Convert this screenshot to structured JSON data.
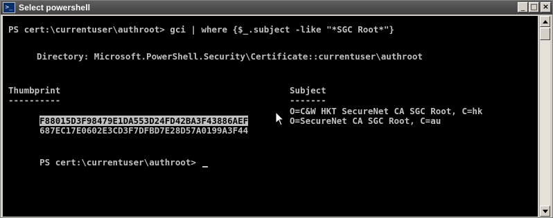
{
  "window": {
    "title": "Select powershell",
    "icon_text": ">_",
    "minimize_label": "_",
    "maximize_label": "□",
    "close_label": "×"
  },
  "console": {
    "command_line": "PS cert:\\currentuser\\authroot> gci | where {$_.subject -like \"*SGC Root*\"}",
    "directory_line": "Directory: Microsoft.PowerShell.Security\\Certificate::currentuser\\authroot",
    "headers": {
      "thumbprint": "Thumbprint",
      "subject": "Subject"
    },
    "underlines": {
      "thumbprint": "----------",
      "subject": "-------"
    },
    "rows": [
      {
        "thumbprint": "F88015D3F98479E1DA553D24FD42BA3F43886AEF",
        "subject": "O=C&W HKT SecureNet CA SGC Root, C=hk"
      },
      {
        "thumbprint": "687EC17E0602E3CD3F7DFBD7E28D57A0199A3F44",
        "subject": "O=SecureNet CA SGC Root, C=au"
      }
    ],
    "prompt_line": "PS cert:\\currentuser\\authroot> "
  },
  "colors": {
    "console_bg": "#000000",
    "console_fg": "#c0c0c0",
    "selection_bg": "#c0c0c0",
    "titlebar": "#4a4a4a"
  }
}
